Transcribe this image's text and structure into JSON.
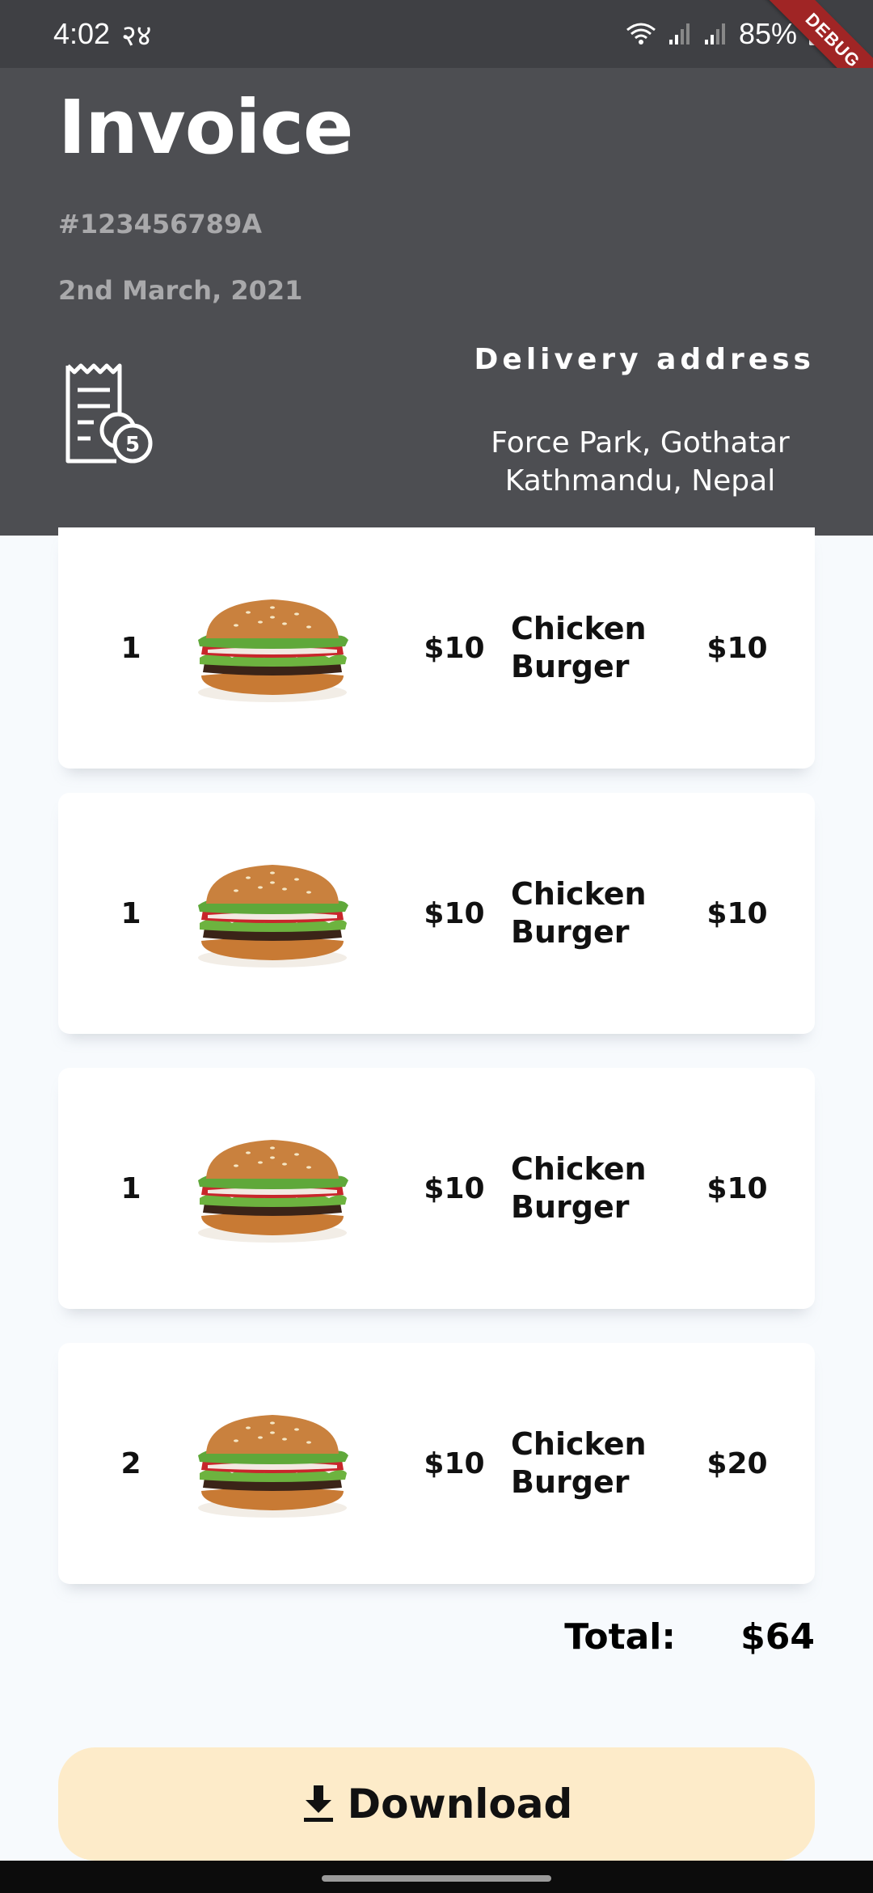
{
  "status_bar": {
    "time": "4:02",
    "extra": "२४",
    "battery": "85%"
  },
  "debug_banner": "DEBUG",
  "invoice": {
    "title": "Invoice",
    "number": "#123456789A",
    "date": "2nd March, 2021",
    "receipt_badge": "5"
  },
  "delivery": {
    "heading": "Delivery address",
    "line1": "Force Park, Gothatar",
    "line2": "Kathmandu, Nepal"
  },
  "items": [
    {
      "qty": "1",
      "price": "$10",
      "name_line1": "Chicken",
      "name_line2": "Burger",
      "total": "$10"
    },
    {
      "qty": "1",
      "price": "$10",
      "name_line1": "Chicken",
      "name_line2": "Burger",
      "total": "$10"
    },
    {
      "qty": "1",
      "price": "$10",
      "name_line1": "Chicken",
      "name_line2": "Burger",
      "total": "$10"
    },
    {
      "qty": "2",
      "price": "$10",
      "name_line1": "Chicken",
      "name_line2": "Burger",
      "total": "$20"
    }
  ],
  "summary": {
    "total_label": "Total:",
    "total_value": "$64"
  },
  "actions": {
    "download_label": "Download"
  },
  "colors": {
    "header_bg": "#4d4e52",
    "status_bg": "#3f4044",
    "button_bg": "#fdebc9",
    "page_bg": "#f7fafd"
  }
}
